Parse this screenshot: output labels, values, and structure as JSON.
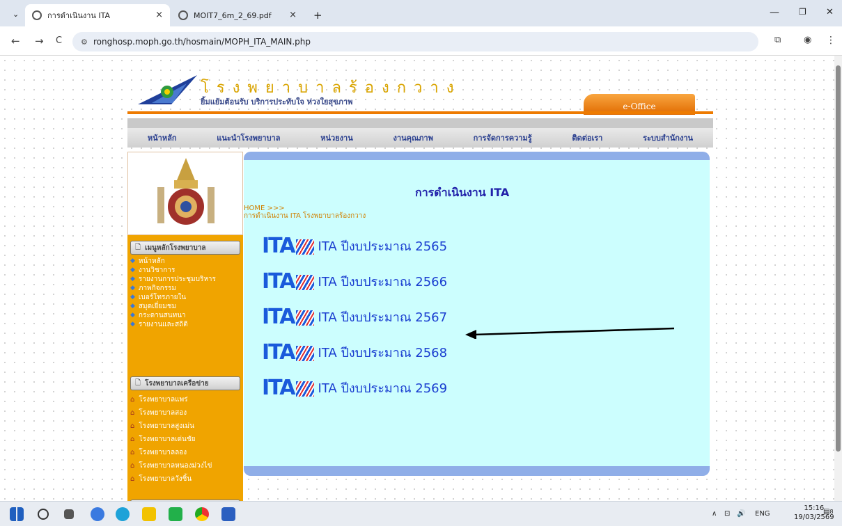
{
  "browser": {
    "tabs": [
      {
        "title": "การดำเนินงาน ITA",
        "active": true
      },
      {
        "title": "MOIT7_6m_2_69.pdf",
        "active": false
      }
    ],
    "new_tab": "+",
    "url": "ronghosp.moph.go.th/hosmain/MOPH_ITA_MAIN.php",
    "back": "←",
    "forward": "→",
    "reload": "C",
    "min": "—",
    "restore": "❐",
    "close": "✕"
  },
  "site": {
    "hospital_name": "โรงพยาบาลร้องกวาง",
    "slogan": "ยิ้มแย้มต้อนรับ บริการประทับใจ ห่วงใยสุขภาพ",
    "eoffice": "e-Office",
    "menu": [
      "หน้าหลัก",
      "แนะนำโรงพยาบาล",
      "หน่วยงาน",
      "งานคุณภาพ",
      "การจัดการความรู้",
      "ติดต่อเรา",
      "ระบบสำนักงาน"
    ]
  },
  "sidebar": {
    "section1": "เมนูหลักโรงพยาบาล",
    "items1": [
      "หน้าหลัก",
      "งานวิชาการ",
      "รายงานการประชุมบริหาร",
      "ภาพกิจกรรม",
      "เบอร์โทรภายใน",
      "สมุดเยี่ยมชม",
      "กระดานสนทนา",
      "รายงานและสถิติ"
    ],
    "section2": "โรงพยาบาลเครือข่าย",
    "items2": [
      "โรงพยาบาลแพร่",
      "โรงพยาบาลสอง",
      "โรงพยาบาลสูงเม่น",
      "โรงพยาบาลเด่นชัย",
      "โรงพยาบาลลอง",
      "โรงพยาบาลหนองม่วงไข่",
      "โรงพยาบาลวังชิ้น"
    ]
  },
  "main": {
    "title": "การดำเนินงาน ITA",
    "breadcrumb_home": "HOME >>>",
    "breadcrumb_page": "การดำเนินงาน ITA โรงพยาบาลร้องกวาง",
    "logo_text": "ITA",
    "items": [
      "ITA ปีงบประมาณ 2565",
      "ITA ปีงบประมาณ 2566",
      "ITA ปีงบประมาณ 2567",
      "ITA ปีงบประมาณ 2568",
      "ITA ปีงบประมาณ 2569"
    ]
  },
  "taskbar": {
    "lang": "ENG",
    "time": "15:16",
    "date": "19/03/2569",
    "notif": "8"
  }
}
